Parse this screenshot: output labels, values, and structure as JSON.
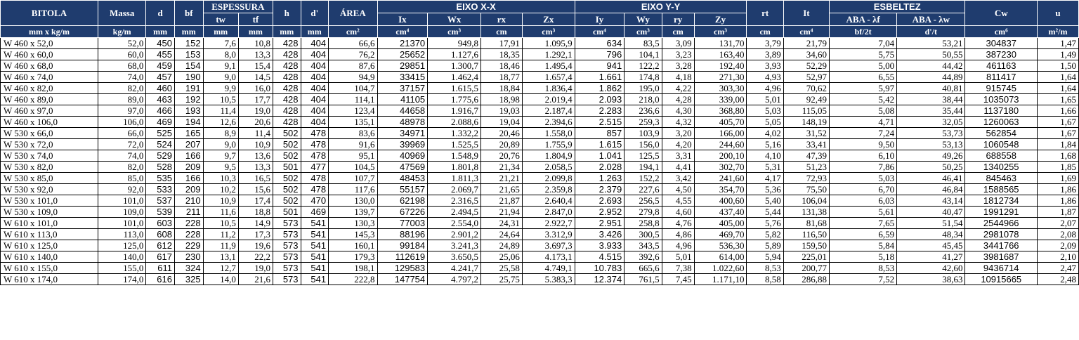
{
  "header": {
    "row1": {
      "bitola": "BITOLA",
      "massa": "Massa",
      "d": "d",
      "bf": "bf",
      "espessura": "ESPESSURA",
      "h": "h",
      "dl": "d'",
      "area": "ÁREA",
      "eixo_x": "EIXO X-X",
      "eixo_y": "EIXO Y-Y",
      "rt": "rt",
      "it": "It",
      "esbeltez": "ESBELTEZ",
      "cw": "Cw",
      "u": "u"
    },
    "row2": {
      "tw": "tw",
      "tf": "tf",
      "ix": "Ix",
      "wx": "Wx",
      "rx": "rx",
      "zx": "Zx",
      "iy": "Iy",
      "wy": "Wy",
      "ry": "ry",
      "zy": "Zy",
      "aba_f": "ABA - λf",
      "aba_w": "ABA - λw"
    },
    "units": [
      "mm x kg/m",
      "kg/m",
      "mm",
      "mm",
      "mm",
      "mm",
      "mm",
      "mm",
      "cm²",
      "cm⁴",
      "cm³",
      "cm",
      "cm³",
      "cm⁴",
      "cm³",
      "cm",
      "cm³",
      "cm",
      "cm⁴",
      "bf/2t",
      "d'/t",
      "cm⁶",
      "m²/m"
    ]
  },
  "rows": [
    [
      "W 460 x 52,0",
      "52,0",
      "450",
      "152",
      "7,6",
      "10,8",
      "428",
      "404",
      "66,6",
      "21370",
      "949,8",
      "17,91",
      "1.095,9",
      "634",
      "83,5",
      "3,09",
      "131,70",
      "3,79",
      "21,79",
      "7,04",
      "53,21",
      "304837",
      "1,47"
    ],
    [
      "W 460 x 60,0",
      "60,0",
      "455",
      "153",
      "8,0",
      "13,3",
      "428",
      "404",
      "76,2",
      "25652",
      "1.127,6",
      "18,35",
      "1.292,1",
      "796",
      "104,1",
      "3,23",
      "163,40",
      "3,89",
      "34,60",
      "5,75",
      "50,55",
      "387230",
      "1,49"
    ],
    [
      "W 460 x 68,0",
      "68,0",
      "459",
      "154",
      "9,1",
      "15,4",
      "428",
      "404",
      "87,6",
      "29851",
      "1.300,7",
      "18,46",
      "1.495,4",
      "941",
      "122,2",
      "3,28",
      "192,40",
      "3,93",
      "52,29",
      "5,00",
      "44,42",
      "461163",
      "1,50"
    ],
    [
      "W 460 x 74,0",
      "74,0",
      "457",
      "190",
      "9,0",
      "14,5",
      "428",
      "404",
      "94,9",
      "33415",
      "1.462,4",
      "18,77",
      "1.657,4",
      "1.661",
      "174,8",
      "4,18",
      "271,30",
      "4,93",
      "52,97",
      "6,55",
      "44,89",
      "811417",
      "1,64"
    ],
    [
      "W 460 x 82,0",
      "82,0",
      "460",
      "191",
      "9,9",
      "16,0",
      "428",
      "404",
      "104,7",
      "37157",
      "1.615,5",
      "18,84",
      "1.836,4",
      "1.862",
      "195,0",
      "4,22",
      "303,30",
      "4,96",
      "70,62",
      "5,97",
      "40,81",
      "915745",
      "1,64"
    ],
    [
      "W 460 x 89,0",
      "89,0",
      "463",
      "192",
      "10,5",
      "17,7",
      "428",
      "404",
      "114,1",
      "41105",
      "1.775,6",
      "18,98",
      "2.019,4",
      "2.093",
      "218,0",
      "4,28",
      "339,00",
      "5,01",
      "92,49",
      "5,42",
      "38,44",
      "1035073",
      "1,65"
    ],
    [
      "W 460 x 97,0",
      "97,0",
      "466",
      "193",
      "11,4",
      "19,0",
      "428",
      "404",
      "123,4",
      "44658",
      "1.916,7",
      "19,03",
      "2.187,4",
      "2.283",
      "236,6",
      "4,30",
      "368,80",
      "5,03",
      "115,05",
      "5,08",
      "35,44",
      "1137180",
      "1,66"
    ],
    [
      "W 460 x 106,0",
      "106,0",
      "469",
      "194",
      "12,6",
      "20,6",
      "428",
      "404",
      "135,1",
      "48978",
      "2.088,6",
      "19,04",
      "2.394,6",
      "2.515",
      "259,3",
      "4,32",
      "405,70",
      "5,05",
      "148,19",
      "4,71",
      "32,05",
      "1260063",
      "1,67"
    ],
    [
      "W 530 x 66,0",
      "66,0",
      "525",
      "165",
      "8,9",
      "11,4",
      "502",
      "478",
      "83,6",
      "34971",
      "1.332,2",
      "20,46",
      "1.558,0",
      "857",
      "103,9",
      "3,20",
      "166,00",
      "4,02",
      "31,52",
      "7,24",
      "53,73",
      "562854",
      "1,67"
    ],
    [
      "W 530 x 72,0",
      "72,0",
      "524",
      "207",
      "9,0",
      "10,9",
      "502",
      "478",
      "91,6",
      "39969",
      "1.525,5",
      "20,89",
      "1.755,9",
      "1.615",
      "156,0",
      "4,20",
      "244,60",
      "5,16",
      "33,41",
      "9,50",
      "53,13",
      "1060548",
      "1,84"
    ],
    [
      "W 530 x 74,0",
      "74,0",
      "529",
      "166",
      "9,7",
      "13,6",
      "502",
      "478",
      "95,1",
      "40969",
      "1.548,9",
      "20,76",
      "1.804,9",
      "1.041",
      "125,5",
      "3,31",
      "200,10",
      "4,10",
      "47,39",
      "6,10",
      "49,26",
      "688558",
      "1,68"
    ],
    [
      "W 530 x 82,0",
      "82,0",
      "528",
      "209",
      "9,5",
      "13,3",
      "501",
      "477",
      "104,5",
      "47569",
      "1.801,8",
      "21,34",
      "2.058,5",
      "2.028",
      "194,1",
      "4,41",
      "302,70",
      "5,31",
      "51,23",
      "7,86",
      "50,25",
      "1340255",
      "1,85"
    ],
    [
      "W 530 x 85,0",
      "85,0",
      "535",
      "166",
      "10,3",
      "16,5",
      "502",
      "478",
      "107,7",
      "48453",
      "1.811,3",
      "21,21",
      "2.099,8",
      "1.263",
      "152,2",
      "3,42",
      "241,60",
      "4,17",
      "72,93",
      "5,03",
      "46,41",
      "845463",
      "1,69"
    ],
    [
      "W 530 x 92,0",
      "92,0",
      "533",
      "209",
      "10,2",
      "15,6",
      "502",
      "478",
      "117,6",
      "55157",
      "2.069,7",
      "21,65",
      "2.359,8",
      "2.379",
      "227,6",
      "4,50",
      "354,70",
      "5,36",
      "75,50",
      "6,70",
      "46,84",
      "1588565",
      "1,86"
    ],
    [
      "W 530 x 101,0",
      "101,0",
      "537",
      "210",
      "10,9",
      "17,4",
      "502",
      "470",
      "130,0",
      "62198",
      "2.316,5",
      "21,87",
      "2.640,4",
      "2.693",
      "256,5",
      "4,55",
      "400,60",
      "5,40",
      "106,04",
      "6,03",
      "43,14",
      "1812734",
      "1,86"
    ],
    [
      "W 530 x 109,0",
      "109,0",
      "539",
      "211",
      "11,6",
      "18,8",
      "501",
      "469",
      "139,7",
      "67226",
      "2.494,5",
      "21,94",
      "2.847,0",
      "2.952",
      "279,8",
      "4,60",
      "437,40",
      "5,44",
      "131,38",
      "5,61",
      "40,47",
      "1991291",
      "1,87"
    ],
    [
      "W 610 x 101,0",
      "101,0",
      "603",
      "228",
      "10,5",
      "14,9",
      "573",
      "541",
      "130,3",
      "77003",
      "2.554,0",
      "24,31",
      "2.922,7",
      "2.951",
      "258,8",
      "4,76",
      "405,00",
      "5,76",
      "81,68",
      "7,65",
      "51,54",
      "2544966",
      "2,07"
    ],
    [
      "W 610 x 113,0",
      "113,0",
      "608",
      "228",
      "11,2",
      "17,3",
      "573",
      "541",
      "145,3",
      "88196",
      "2.901,2",
      "24,64",
      "3.312,9",
      "3.426",
      "300,5",
      "4,86",
      "469,70",
      "5,82",
      "116,50",
      "6,59",
      "48,34",
      "2981078",
      "2,08"
    ],
    [
      "W 610 x 125,0",
      "125,0",
      "612",
      "229",
      "11,9",
      "19,6",
      "573",
      "541",
      "160,1",
      "99184",
      "3.241,3",
      "24,89",
      "3.697,3",
      "3.933",
      "343,5",
      "4,96",
      "536,30",
      "5,89",
      "159,50",
      "5,84",
      "45,45",
      "3441766",
      "2,09"
    ],
    [
      "W 610 x 140,0",
      "140,0",
      "617",
      "230",
      "13,1",
      "22,2",
      "573",
      "541",
      "179,3",
      "112619",
      "3.650,5",
      "25,06",
      "4.173,1",
      "4.515",
      "392,6",
      "5,01",
      "614,00",
      "5,94",
      "225,01",
      "5,18",
      "41,27",
      "3981687",
      "2,10"
    ],
    [
      "W 610 x 155,0",
      "155,0",
      "611",
      "324",
      "12,7",
      "19,0",
      "573",
      "541",
      "198,1",
      "129583",
      "4.241,7",
      "25,58",
      "4.749,1",
      "10.783",
      "665,6",
      "7,38",
      "1.022,60",
      "8,53",
      "200,77",
      "8,53",
      "42,60",
      "9436714",
      "2,47"
    ],
    [
      "W 610 x 174,0",
      "174,0",
      "616",
      "325",
      "14,0",
      "21,6",
      "573",
      "541",
      "222,8",
      "147754",
      "4.797,2",
      "25,75",
      "5.383,3",
      "12.374",
      "761,5",
      "7,45",
      "1.171,10",
      "8,58",
      "286,88",
      "7,52",
      "38,63",
      "10915665",
      "2,48"
    ]
  ],
  "colors": {
    "header_bg": "#1f3c6e",
    "header_text": "#ffffff",
    "border": "#000000"
  }
}
